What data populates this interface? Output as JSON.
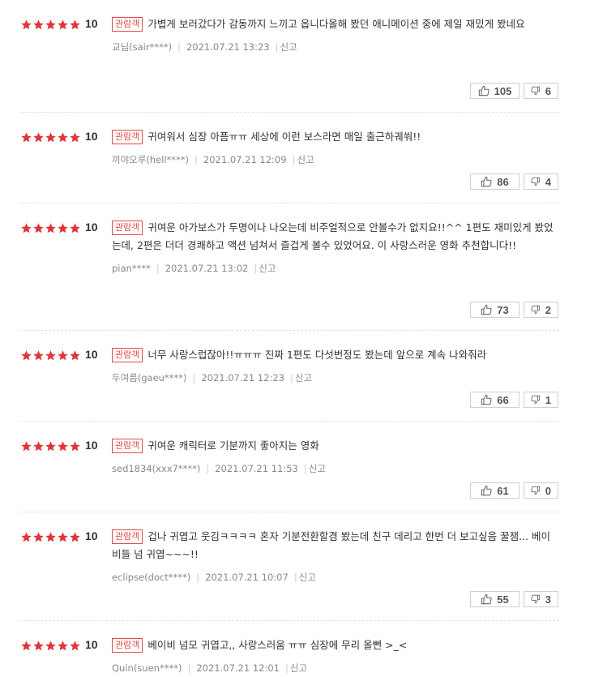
{
  "reviews": [
    {
      "rating": "10",
      "badge": "관람객",
      "text": "가볍게 보러갔다가 감동까지 느끼고 옵니다올해 봤던 애니메이션 중에 제일 재밌게 봤네요",
      "author": "교님(sair****)",
      "date": "2021.07.21 13:23",
      "report": "신고",
      "likes": "105",
      "dislikes": "6"
    },
    {
      "rating": "10",
      "badge": "관람객",
      "text": "귀여워서 심장 아픔ㅠㅠ 세상에 이런 보스라면 매일 출근하궤쒀!!",
      "author": "끼야오루(hell****)",
      "date": "2021.07.21 12:09",
      "report": "신고",
      "likes": "86",
      "dislikes": "4"
    },
    {
      "rating": "10",
      "badge": "관람객",
      "text": "귀여운 아가보스가 두명이나 나오는데 비주얼적으로 안볼수가 없지요!!^^ 1편도 재미있게 봤었는데, 2편은 더더 경쾌하고 액션 넘쳐서 즐겁게 볼수 있었어요. 이 사랑스러운 영화 추천합니다!!",
      "author": "pian****",
      "date": "2021.07.21 13:02",
      "report": "신고",
      "likes": "73",
      "dislikes": "2"
    },
    {
      "rating": "10",
      "badge": "관람객",
      "text": "너무 사랑스럽잖아!!ㅠㅠㅠ 진짜 1편도 다섯번정도 봤는데 앞으로 계속 나와줘라",
      "author": "두여름(gaeu****)",
      "date": "2021.07.21 12:23",
      "report": "신고",
      "likes": "66",
      "dislikes": "1"
    },
    {
      "rating": "10",
      "badge": "관람객",
      "text": "귀여운 캐릭터로 기분까지 좋아지는 영화",
      "author": "sed1834(xxx7****)",
      "date": "2021.07.21 11:53",
      "report": "신고",
      "likes": "61",
      "dislikes": "0"
    },
    {
      "rating": "10",
      "badge": "관람객",
      "text": "겁나 귀엽고 웃김ㅋㅋㅋㅋ 혼자 기분전환할겸 봤는데 친구 데리고 한번 더 보고싶음 꿀잼... 베이비들 넘 귀엽~~~!!",
      "author": "eclipse(doct****)",
      "date": "2021.07.21 10:07",
      "report": "신고",
      "likes": "55",
      "dislikes": "3"
    },
    {
      "rating": "10",
      "badge": "관람객",
      "text": "베이비 넘모 귀엽고,, 사랑스러움 ㅠㅠ 심장에 무리 올뻔 >_<",
      "author": "Quin(suen****)",
      "date": "2021.07.21 12:01",
      "report": "신고",
      "likes": "",
      "dislikes": ""
    }
  ],
  "icons": {
    "star": "star-icon",
    "like": "thumbs-up-icon",
    "dislike": "thumbs-down-icon"
  },
  "colors": {
    "star": "#e3343a",
    "badge": "#e34a4a"
  }
}
